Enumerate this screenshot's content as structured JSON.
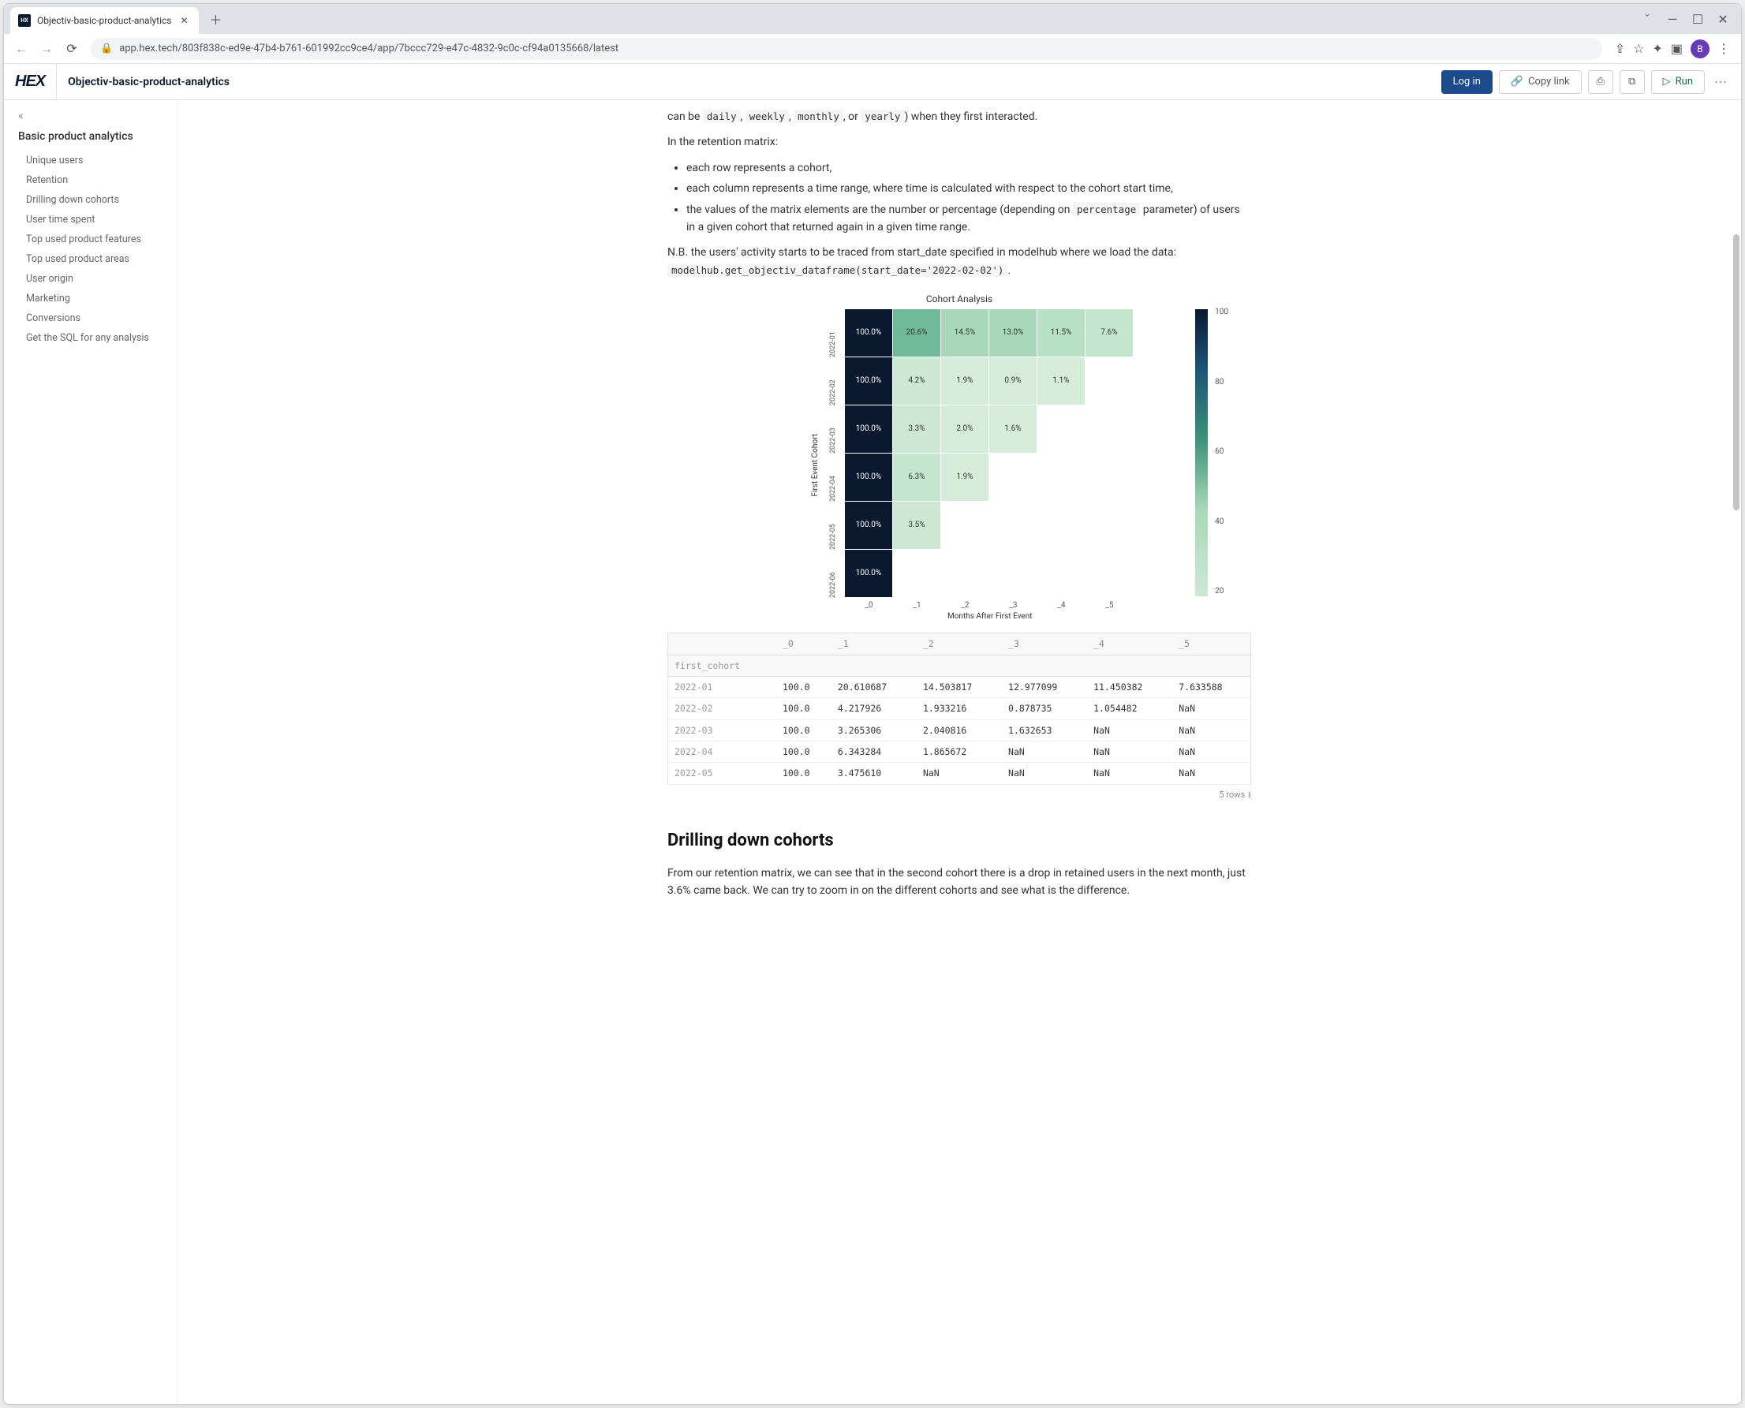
{
  "browser": {
    "tab_title": "Objectiv-basic-product-analytics",
    "url": "app.hex.tech/803f838c-ed9e-47b4-b761-601992cc9ce4/app/7bccc729-e47c-4832-9c0c-cf94a0135668/latest",
    "avatar_letter": "B"
  },
  "header": {
    "logo_text": "HEX",
    "project_title": "Objectiv-basic-product-analytics",
    "login_label": "Log in",
    "copy_link_label": "Copy link",
    "run_label": "Run"
  },
  "sidebar": {
    "title": "Basic product analytics",
    "items": [
      "Unique users",
      "Retention",
      "Drilling down cohorts",
      "User time spent",
      "Top used product features",
      "Top used product areas",
      "User origin",
      "Marketing",
      "Conversions",
      "Get the SQL for any analysis"
    ]
  },
  "article": {
    "p_intro_prefix": "can be ",
    "code_daily": "daily",
    "code_weekly": "weekly",
    "code_monthly": "monthly",
    "p_intro_or": ", or ",
    "code_yearly": "yearly",
    "p_intro_suffix": ") when they first interacted.",
    "p_matrix_header": "In the retention matrix:",
    "bullet1": "each row represents a cohort,",
    "bullet2": "each column represents a time range, where time is calculated with respect to the cohort start time,",
    "bullet3_pre": "the values of the matrix elements are the number or percentage (depending on ",
    "bullet3_code": "percentage",
    "bullet3_post": " parameter) of users in a given cohort that returned again in a given time range.",
    "p_nb": "N.B. the users' activity starts to be traced from start_date specified in modelhub where we load the data:",
    "code_snippet": "modelhub.get_objectiv_dataframe(start_date='2022-02-02')",
    "code_snippet_after": ".",
    "h2_drill": "Drilling down cohorts",
    "p_drill": "From our retention matrix, we can see that in the second cohort there is a drop in retained users in the next month, just 3.6% came back. We can try to zoom in on the different cohorts and see what is the difference."
  },
  "chart_data": {
    "type": "heatmap",
    "title": "Cohort Analysis",
    "xlabel": "Months After First Event",
    "ylabel": "First Event Cohort",
    "x_categories": [
      "_0",
      "_1",
      "_2",
      "_3",
      "_4",
      "_5"
    ],
    "y_categories": [
      "2022-01",
      "2022-02",
      "2022-03",
      "2022-04",
      "2022-05",
      "2022-06"
    ],
    "matrix_display": [
      [
        "100.0%",
        "20.6%",
        "14.5%",
        "13.0%",
        "11.5%",
        "7.6%"
      ],
      [
        "100.0%",
        "4.2%",
        "1.9%",
        "0.9%",
        "1.1%",
        null
      ],
      [
        "100.0%",
        "3.3%",
        "2.0%",
        "1.6%",
        null,
        null
      ],
      [
        "100.0%",
        "6.3%",
        "1.9%",
        null,
        null,
        null
      ],
      [
        "100.0%",
        "3.5%",
        null,
        null,
        null,
        null
      ],
      [
        "100.0%",
        null,
        null,
        null,
        null,
        null
      ]
    ],
    "matrix_values": [
      [
        100.0,
        20.6,
        14.5,
        13.0,
        11.5,
        7.6
      ],
      [
        100.0,
        4.2,
        1.9,
        0.9,
        1.1,
        null
      ],
      [
        100.0,
        3.3,
        2.0,
        1.6,
        null,
        null
      ],
      [
        100.0,
        6.3,
        1.9,
        null,
        null,
        null
      ],
      [
        100.0,
        3.5,
        null,
        null,
        null,
        null
      ],
      [
        100.0,
        null,
        null,
        null,
        null,
        null
      ]
    ],
    "colorbar_ticks": [
      "100",
      "80",
      "60",
      "40",
      "20"
    ]
  },
  "table": {
    "index_label": "first_cohort",
    "columns": [
      "_0",
      "_1",
      "_2",
      "_3",
      "_4",
      "_5"
    ],
    "rows": [
      {
        "idx": "2022-01",
        "cells": [
          "100.0",
          "20.610687",
          "14.503817",
          "12.977099",
          "11.450382",
          "7.633588"
        ]
      },
      {
        "idx": "2022-02",
        "cells": [
          "100.0",
          "4.217926",
          "1.933216",
          "0.878735",
          "1.054482",
          "NaN"
        ]
      },
      {
        "idx": "2022-03",
        "cells": [
          "100.0",
          "3.265306",
          "2.040816",
          "1.632653",
          "NaN",
          "NaN"
        ]
      },
      {
        "idx": "2022-04",
        "cells": [
          "100.0",
          "6.343284",
          "1.865672",
          "NaN",
          "NaN",
          "NaN"
        ]
      },
      {
        "idx": "2022-05",
        "cells": [
          "100.0",
          "3.475610",
          "NaN",
          "NaN",
          "NaN",
          "NaN"
        ]
      }
    ],
    "footer": "5 rows"
  }
}
